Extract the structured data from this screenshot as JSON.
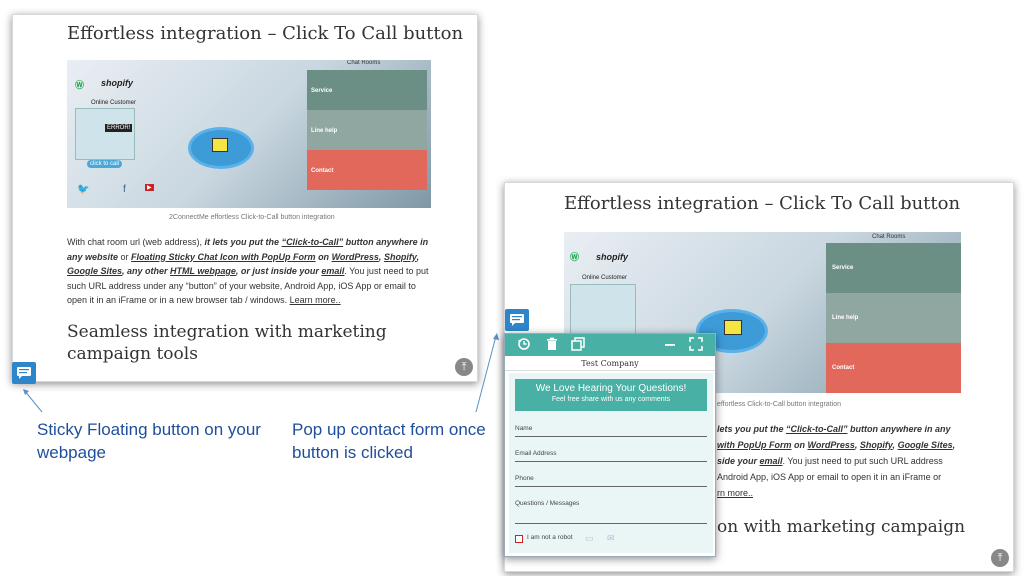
{
  "left_shot": {
    "title": "Effortless integration – Click To Call button",
    "caption": "2ConnectMe effortless Click-to-Call button integration",
    "para": {
      "p1": "With chat room url (web address), ",
      "p2": "it lets you put the ",
      "p3": "“Click-to-Call”",
      "p4": " button anywhere in any website",
      "p5": " or ",
      "p6": "Floating Sticky Chat Icon with PopUp Form",
      "p7": " on ",
      "p8": "WordPress",
      "p9": ", ",
      "p10": "Shopify",
      "p11": ", ",
      "p12": "Google Sites",
      "p13": ", any other ",
      "p14": "HTML webpage",
      "p15": ", or just inside your ",
      "p16": "email",
      "p17": ". You just need to put such URL address under any “button” of your website, Android App, iOS App or email to open it in an iFrame or in a new browser tab / windows. ",
      "p18": "Learn more.."
    },
    "heading2": "Seamless integration with marketing campaign tools"
  },
  "right_shot": {
    "title": "Effortless integration – Click To Call button",
    "caption": "effortless Click-to-Call button integration",
    "para": {
      "l1a": "lets you put the ",
      "l1b": "“Click-to-Call”",
      "l1c": " button anywhere in any",
      "l2a": " with PopUp Form",
      "l2b": " on ",
      "l2c": "WordPress",
      "l2d": ", ",
      "l2e": "Shopify",
      "l2f": ", ",
      "l2g": "Google Sites",
      "l2h": ",",
      "l3a": "side your ",
      "l3b": "email",
      "l3c": ". You just need to put such URL address",
      "l4": "Android App, iOS App or email to open it in an iFrame or",
      "l5": "rn more.."
    },
    "heading2": "on with marketing campaign"
  },
  "illustration": {
    "chat_rooms": "Chat Rooms",
    "online_customer": "Online Customer",
    "shopify": "shopify",
    "service": "Service",
    "line_help": "Line help",
    "contact": "Contact",
    "click_to_call": "click to call",
    "error": "ERROR!"
  },
  "popup": {
    "company": "Test Company",
    "heading": "We Love Hearing Your Questions!",
    "subheading": "Feel free share with us any comments",
    "name_label": "Name",
    "email_label": "Email Address",
    "phone_label": "Phone",
    "message_label": "Questions / Messages",
    "captcha_label": "I am not a robot"
  },
  "notes": {
    "sticky": "Sticky Floating button on your webpage",
    "popup": "Pop up contact form once button is clicked"
  },
  "colors": {
    "accent_teal": "#48b0a4",
    "sticky_blue": "#2e86c9",
    "note_blue": "#1f4e9b"
  },
  "icons": [
    "history-icon",
    "trash-icon",
    "copy-icon",
    "minimize-icon",
    "fullscreen-icon",
    "chat-icon",
    "arrow-up-icon",
    "message-icon",
    "mail-icon"
  ]
}
